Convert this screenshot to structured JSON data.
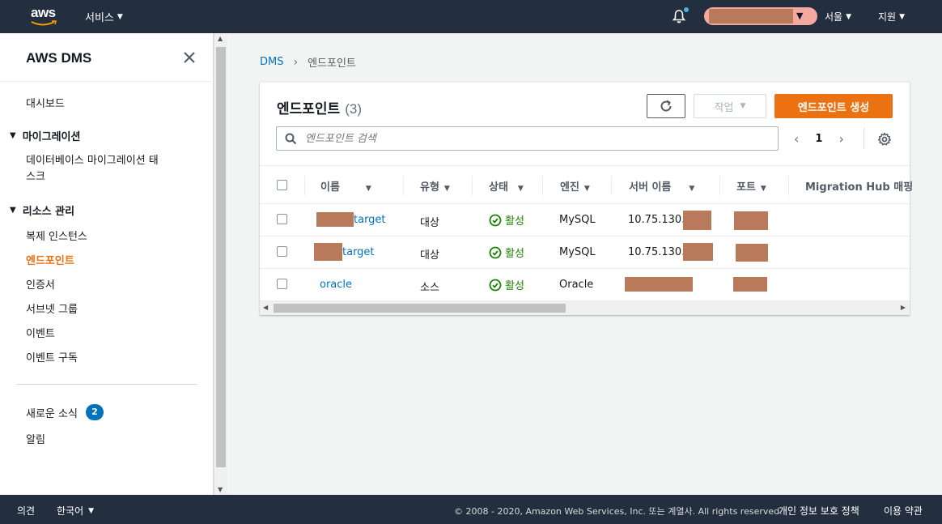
{
  "topnav": {
    "logo_text": "aws",
    "services_label": "서비스",
    "region_label": "서울",
    "support_label": "지원"
  },
  "sidebar": {
    "title": "AWS DMS",
    "dashboard": "대시보드",
    "migration_section": "마이그레이션",
    "migration_task_line1": "데이터베이스 마이그레이션 태",
    "migration_task_line2": "스크",
    "resource_section": "리소스 관리",
    "items": [
      "복제 인스턴스",
      "엔드포인트",
      "인증서",
      "서브넷 그룹",
      "이벤트",
      "이벤트 구독"
    ],
    "news_label": "새로운 소식",
    "news_count": "2",
    "alerts_label": "알림"
  },
  "breadcrumb": {
    "root": "DMS",
    "current": "엔드포인트"
  },
  "panel": {
    "title": "엔드포인트",
    "count": "(3)",
    "actions_label": "작업",
    "create_label": "엔드포인트 생성",
    "search_placeholder": "엔드포인트 검색",
    "page": "1"
  },
  "table": {
    "columns": [
      "이름",
      "유형",
      "상태",
      "엔진",
      "서버 이름",
      "포트",
      "Migration Hub 매핑"
    ],
    "rows": [
      {
        "name": "target",
        "type": "대상",
        "status": "활성",
        "engine": "MySQL",
        "server": "10.75.130."
      },
      {
        "name": "target",
        "type": "대상",
        "status": "활성",
        "engine": "MySQL",
        "server": "10.75.130."
      },
      {
        "name": "oracle",
        "type": "소스",
        "status": "활성",
        "engine": "Oracle",
        "server": ""
      }
    ]
  },
  "footer": {
    "feedback": "의견",
    "language": "한국어",
    "copyright": "© 2008 - 2020, Amazon Web Services, Inc. 또는 계열사. All rights reserved.",
    "privacy": "개인 정보 보호 정책",
    "terms": "이용 약관"
  },
  "colors": {
    "accent": "#ec7211",
    "link": "#0073bb",
    "nav": "#232f3e",
    "success": "#1d8102"
  }
}
